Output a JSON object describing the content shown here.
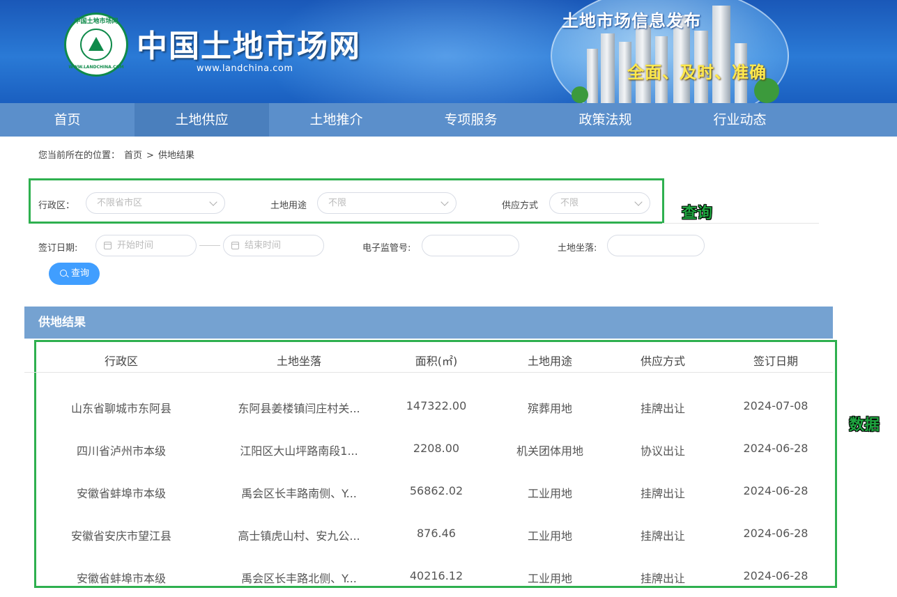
{
  "header": {
    "site_title": "中国土地市场网",
    "site_url": "www.landchina.com",
    "logo_text_top": "中国土地市场网",
    "logo_text_bottom": "WWW.LANDCHINA.COM",
    "ad_title": "土地市场信息发布",
    "ad_subtitle": "全面、及时、准确"
  },
  "nav": {
    "items": [
      "首页",
      "土地供应",
      "土地推介",
      "专项服务",
      "政策法规",
      "行业动态"
    ],
    "active_index": 1
  },
  "breadcrumb": {
    "label": "您当前所在的位置：",
    "home": "首页",
    "sep": ">",
    "current": "供地结果"
  },
  "filters": {
    "region_label": "行政区：",
    "region_placeholder": "不限省市区",
    "use_label": "土地用途",
    "use_placeholder": "不限",
    "supply_label": "供应方式",
    "supply_placeholder": "不限",
    "date_label": "签订日期:",
    "start_placeholder": "开始时间",
    "end_placeholder": "结束时间",
    "monitor_label": "电子监管号:",
    "monitor_value": "",
    "location_label": "土地坐落:",
    "location_value": "",
    "search_label": "查询"
  },
  "annotations": {
    "query": "查询",
    "data": "数据"
  },
  "results": {
    "title": "供地结果",
    "columns": [
      "行政区",
      "土地坐落",
      "面积(㎡)",
      "土地用途",
      "供应方式",
      "签订日期"
    ],
    "rows": [
      [
        "山东省聊城市东阿县",
        "东阿县姜楼镇闫庄村关...",
        "147322.00",
        "殡葬用地",
        "挂牌出让",
        "2024-07-08"
      ],
      [
        "四川省泸州市本级",
        "江阳区大山坪路南段1...",
        "2208.00",
        "机关团体用地",
        "协议出让",
        "2024-06-28"
      ],
      [
        "安徽省蚌埠市本级",
        "禹会区长丰路南侧、Y...",
        "56862.02",
        "工业用地",
        "挂牌出让",
        "2024-06-28"
      ],
      [
        "安徽省安庆市望江县",
        "高士镇虎山村、安九公...",
        "876.46",
        "工业用地",
        "挂牌出让",
        "2024-06-28"
      ],
      [
        "安徽省蚌埠市本级",
        "禹会区长丰路北侧、Y...",
        "40216.12",
        "工业用地",
        "挂牌出让",
        "2024-06-28"
      ]
    ]
  },
  "colors": {
    "nav_bg": "#5b8fcb",
    "nav_active": "#4a7fbd",
    "result_header": "#75a2d1",
    "primary_button": "#409eff",
    "highlight": "#2eb04f"
  }
}
